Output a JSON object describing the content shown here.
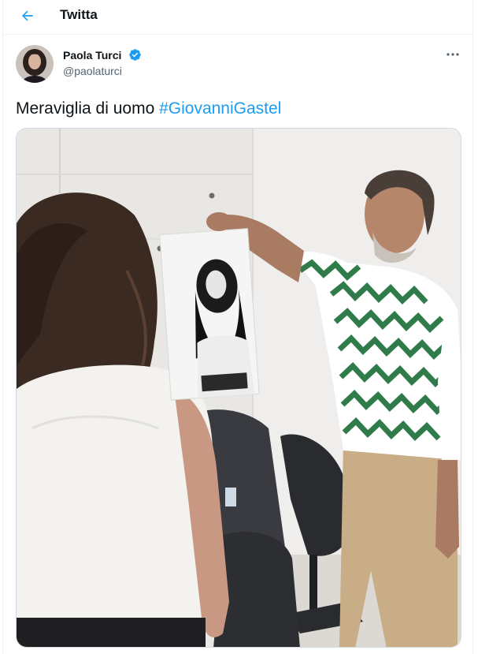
{
  "header": {
    "back_icon": "arrow-left-icon",
    "title": "Twitta"
  },
  "tweet": {
    "author": {
      "name": "Paola Turci",
      "handle": "@paolaturci",
      "verified": true,
      "verified_icon": "verified-badge-icon"
    },
    "more_icon": "more-horizontal-icon",
    "text": "Meraviglia di uomo ",
    "hashtag": "#GiovanniGastel"
  },
  "colors": {
    "accent": "#1d9bf0",
    "text_primary": "#0f1419",
    "text_secondary": "#536471",
    "border": "#eff3f4"
  }
}
